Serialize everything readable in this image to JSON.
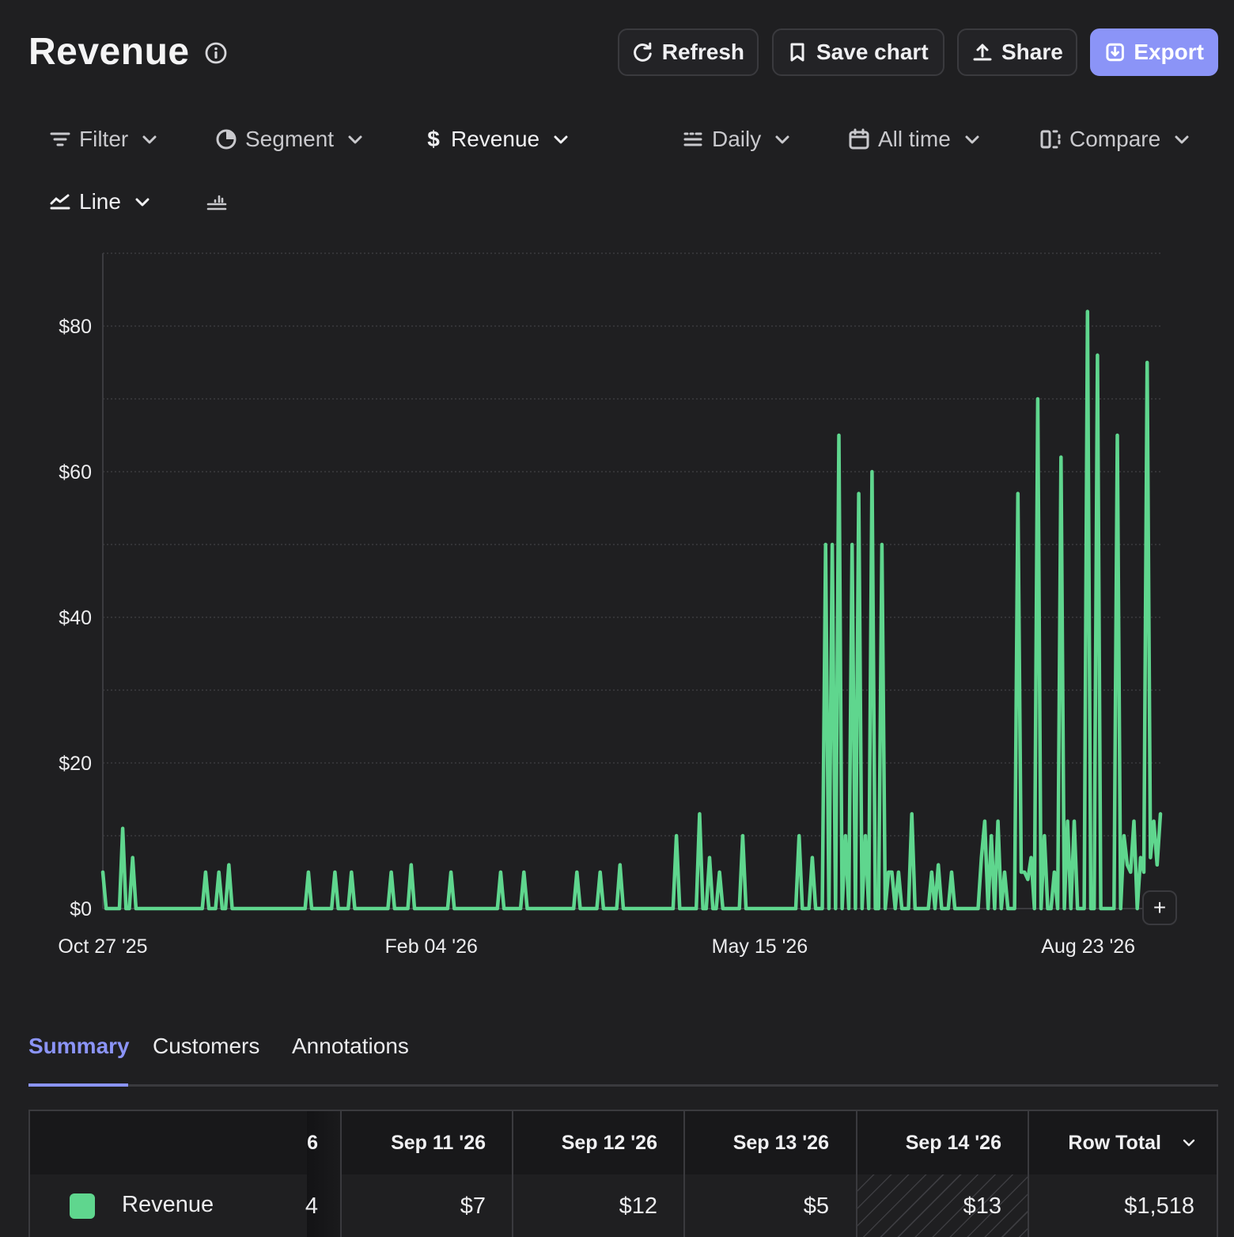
{
  "header": {
    "title": "Revenue",
    "buttons": {
      "refresh": "Refresh",
      "save_chart": "Save chart",
      "share": "Share",
      "export": "Export"
    }
  },
  "toolbar": {
    "filter": "Filter",
    "segment": "Segment",
    "metric": "Revenue",
    "interval": "Daily",
    "range": "All time",
    "compare": "Compare",
    "chart_type": "Line"
  },
  "tabs": [
    "Summary",
    "Customers",
    "Annotations"
  ],
  "table": {
    "partial_header": "6",
    "columns": [
      "Sep 11 '26",
      "Sep 12 '26",
      "Sep 13 '26",
      "Sep 14 '26"
    ],
    "row_total_label": "Row Total",
    "row": {
      "label": "Revenue",
      "partial_value": "4",
      "values": [
        "$7",
        "$12",
        "$5",
        "$13"
      ],
      "total": "$1,518"
    }
  },
  "colors": {
    "series": "#5fd68e",
    "accent": "#8b94f7",
    "background": "#1f1f21"
  },
  "chart_data": {
    "type": "line",
    "ylim": [
      0,
      90
    ],
    "yticks": [
      0,
      20,
      40,
      60,
      80
    ],
    "ytick_labels": [
      "$0",
      "$20",
      "$40",
      "$60",
      "$80"
    ],
    "xtick_labels": [
      "Oct 27 '25",
      "Feb 04 '26",
      "May 15 '26",
      "Aug 23 '26"
    ],
    "x_day_offsets_for_ticks": [
      0,
      100,
      200,
      300
    ],
    "series": [
      {
        "name": "Revenue",
        "values": [
          5,
          0,
          0,
          0,
          0,
          0,
          11,
          0,
          0,
          7,
          0,
          0,
          0,
          0,
          0,
          0,
          0,
          0,
          0,
          0,
          0,
          0,
          0,
          0,
          0,
          0,
          0,
          0,
          0,
          0,
          0,
          5,
          0,
          0,
          0,
          5,
          0,
          0,
          6,
          0,
          0,
          0,
          0,
          0,
          0,
          0,
          0,
          0,
          0,
          0,
          0,
          0,
          0,
          0,
          0,
          0,
          0,
          0,
          0,
          0,
          0,
          0,
          5,
          0,
          0,
          0,
          0,
          0,
          0,
          0,
          5,
          0,
          0,
          0,
          0,
          5,
          0,
          0,
          0,
          0,
          0,
          0,
          0,
          0,
          0,
          0,
          0,
          5,
          0,
          0,
          0,
          0,
          0,
          6,
          0,
          0,
          0,
          0,
          0,
          0,
          0,
          0,
          0,
          0,
          0,
          5,
          0,
          0,
          0,
          0,
          0,
          0,
          0,
          0,
          0,
          0,
          0,
          0,
          0,
          0,
          5,
          0,
          0,
          0,
          0,
          0,
          0,
          5,
          0,
          0,
          0,
          0,
          0,
          0,
          0,
          0,
          0,
          0,
          0,
          0,
          0,
          0,
          0,
          5,
          0,
          0,
          0,
          0,
          0,
          0,
          5,
          0,
          0,
          0,
          0,
          0,
          6,
          0,
          0,
          0,
          0,
          0,
          0,
          0,
          0,
          0,
          0,
          0,
          0,
          0,
          0,
          0,
          0,
          10,
          0,
          0,
          0,
          0,
          0,
          0,
          13,
          0,
          0,
          7,
          0,
          0,
          5,
          0,
          0,
          0,
          0,
          0,
          0,
          10,
          0,
          0,
          0,
          0,
          0,
          0,
          0,
          0,
          0,
          0,
          0,
          0,
          0,
          0,
          0,
          0,
          10,
          0,
          0,
          0,
          7,
          0,
          0,
          0,
          50,
          0,
          50,
          0,
          65,
          0,
          10,
          0,
          50,
          0,
          57,
          0,
          10,
          0,
          60,
          0,
          0,
          50,
          0,
          5,
          5,
          0,
          5,
          0,
          0,
          0,
          13,
          0,
          0,
          0,
          0,
          0,
          5,
          0,
          6,
          0,
          0,
          0,
          5,
          0,
          0,
          0,
          0,
          0,
          0,
          0,
          0,
          7,
          12,
          0,
          10,
          0,
          12,
          0,
          5,
          0,
          0,
          0,
          57,
          5,
          5,
          4,
          7,
          0,
          70,
          0,
          10,
          0,
          0,
          5,
          0,
          62,
          0,
          12,
          0,
          12,
          0,
          0,
          0,
          82,
          0,
          0,
          76,
          0,
          0,
          0,
          0,
          0,
          65,
          0,
          10,
          6,
          5,
          12,
          0,
          7,
          5,
          75,
          7,
          12,
          6,
          13
        ]
      }
    ]
  }
}
